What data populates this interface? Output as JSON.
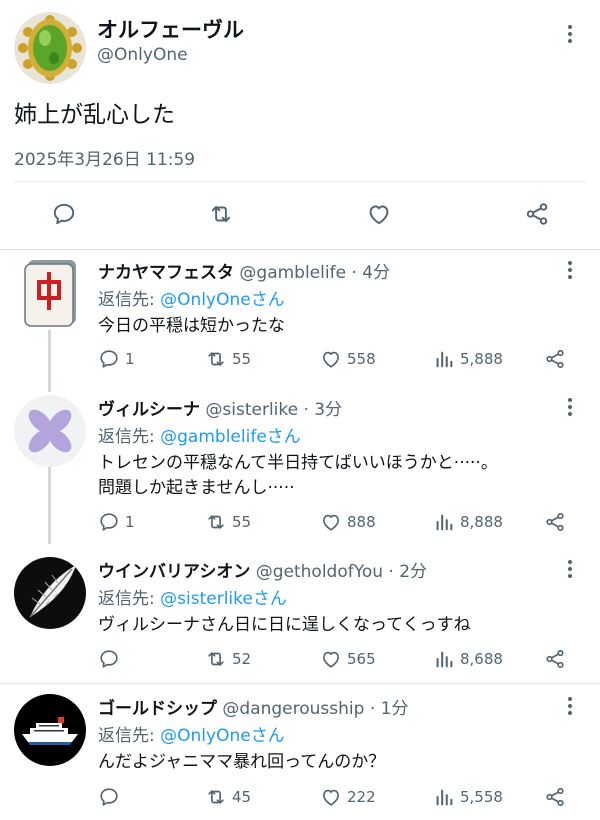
{
  "main_tweet": {
    "display_name": "オルフェーヴル",
    "handle": "@OnlyOne",
    "text": "姉上が乱心した",
    "timestamp": "2025年3月26日 11:59",
    "actions": [
      "reply-icon",
      "retweet-icon",
      "like-icon",
      "share-icon"
    ]
  },
  "replies": [
    {
      "display_name": "ナカヤマフェスタ",
      "meta": " @gamblelife · 4分",
      "reply_prefix": "返信先: ",
      "reply_to": "@OnlyOneさん",
      "lines": [
        "今日の平穏は短かったな"
      ],
      "replies": "1",
      "retweets": "55",
      "likes": "558",
      "views": "5,888",
      "avatar": "mahjong-chun-tile"
    },
    {
      "display_name": "ヴィルシーナ",
      "meta": " @sisterlike · 3分",
      "reply_prefix": "返信先: ",
      "reply_to": "@gamblelifeさん",
      "lines": [
        "トレセンの平穏なんて半日持てばいいほうかと·····。",
        "問題しか起きませんし·····"
      ],
      "replies": "1",
      "retweets": "55",
      "likes": "888",
      "views": "8,888",
      "avatar": "purple-flower"
    },
    {
      "display_name": "ウインバリアシオン",
      "meta": " @getholdofYou · 2分",
      "reply_prefix": "返信先: ",
      "reply_to": "@sisterlikeさん",
      "lines": [
        "ヴィルシーナさん日に日に逞しくなってくっすね"
      ],
      "replies": "",
      "retweets": "52",
      "likes": "565",
      "views": "8,688",
      "avatar": "feather"
    },
    {
      "display_name": "ゴールドシップ",
      "meta": " @dangerousship · 1分",
      "reply_prefix": "返信先: ",
      "reply_to": "@OnlyOneさん",
      "lines": [
        "んだよジャニママ暴れ回ってんのか？"
      ],
      "replies": "",
      "retweets": "45",
      "likes": "222",
      "views": "5,558",
      "avatar": "cruise-ship"
    }
  ],
  "colors": {
    "link": "#1d9bf0",
    "secondary_text": "#536471",
    "primary_text": "#0f1419",
    "thread_line": "#cfd9de",
    "flower": "#b3a4db"
  }
}
